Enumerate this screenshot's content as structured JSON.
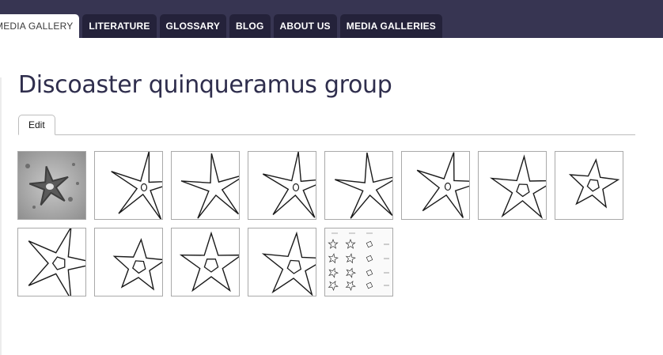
{
  "nav": {
    "tabs": [
      {
        "label": "MEDIA GALLERY",
        "active": true
      },
      {
        "label": "LITERATURE",
        "active": false
      },
      {
        "label": "GLOSSARY",
        "active": false
      },
      {
        "label": "BLOG",
        "active": false
      },
      {
        "label": "ABOUT US",
        "active": false
      },
      {
        "label": "MEDIA GALLERIES",
        "active": false
      }
    ]
  },
  "page": {
    "title": "Discoaster quinqueramus group",
    "edit_tab_label": "Edit"
  },
  "gallery": {
    "thumbnails": [
      {
        "kind": "photo"
      },
      {
        "kind": "sketch",
        "center": "small-oval"
      },
      {
        "kind": "sketch",
        "center": "none"
      },
      {
        "kind": "sketch",
        "center": "small-oval"
      },
      {
        "kind": "sketch",
        "center": "none"
      },
      {
        "kind": "sketch",
        "center": "small-oval"
      },
      {
        "kind": "sketch",
        "center": "pentagon"
      },
      {
        "kind": "sketch",
        "center": "pentagon"
      },
      {
        "kind": "sketch",
        "center": "pentagon"
      },
      {
        "kind": "sketch",
        "center": "pentagon"
      },
      {
        "kind": "sketch",
        "center": "pentagon"
      },
      {
        "kind": "sketch",
        "center": "pentagon"
      },
      {
        "kind": "plate"
      }
    ]
  }
}
